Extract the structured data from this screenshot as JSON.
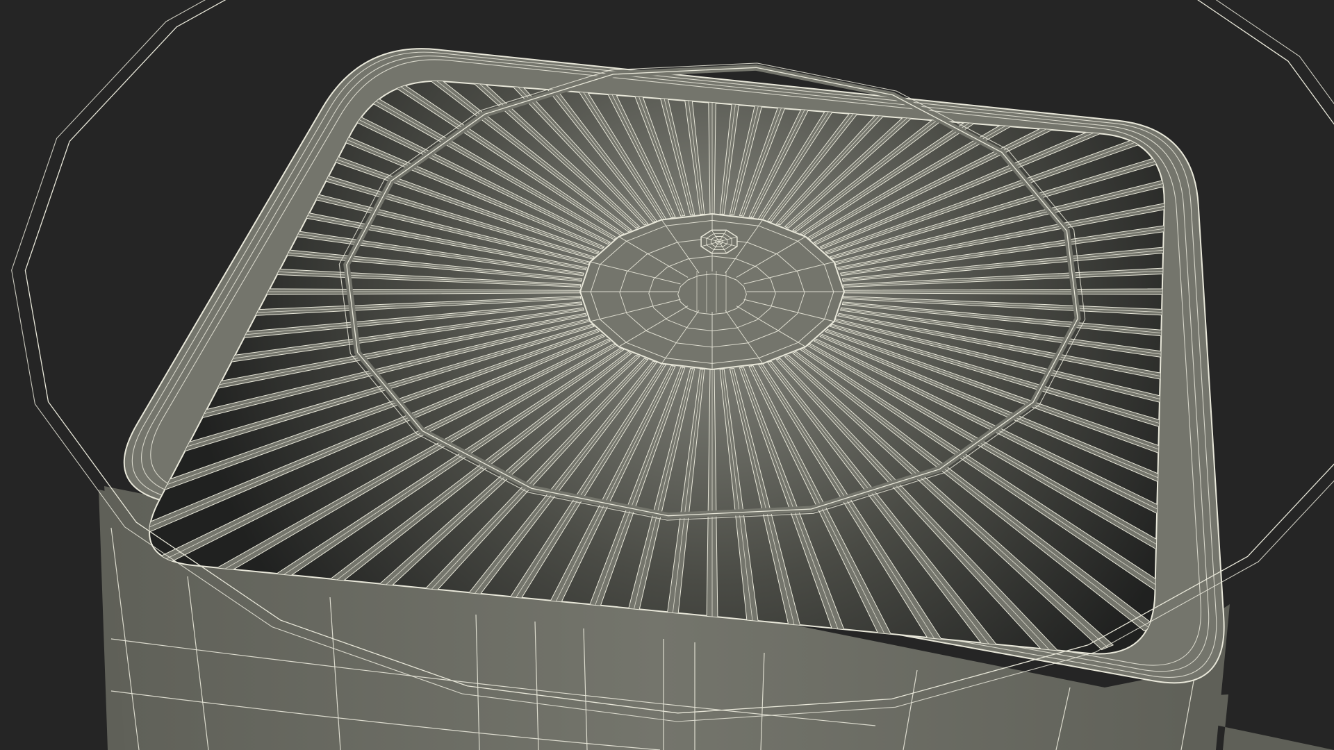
{
  "scene": {
    "subject": "ac-condenser-unit-top",
    "render_style": "wireframe-over-shaded",
    "colors": {
      "background": "#252525",
      "surface": "#74756c",
      "surface_dark": "#5f6058",
      "wire": "#e9e8da",
      "cavity_top": "#8a8b82",
      "cavity_mid": "#4a4b45",
      "cavity_deep": "#202120"
    },
    "grille": {
      "inner_spoke_count": 72,
      "outer_spoke_count": 84,
      "rings": 2,
      "hub_segments": 16
    }
  }
}
